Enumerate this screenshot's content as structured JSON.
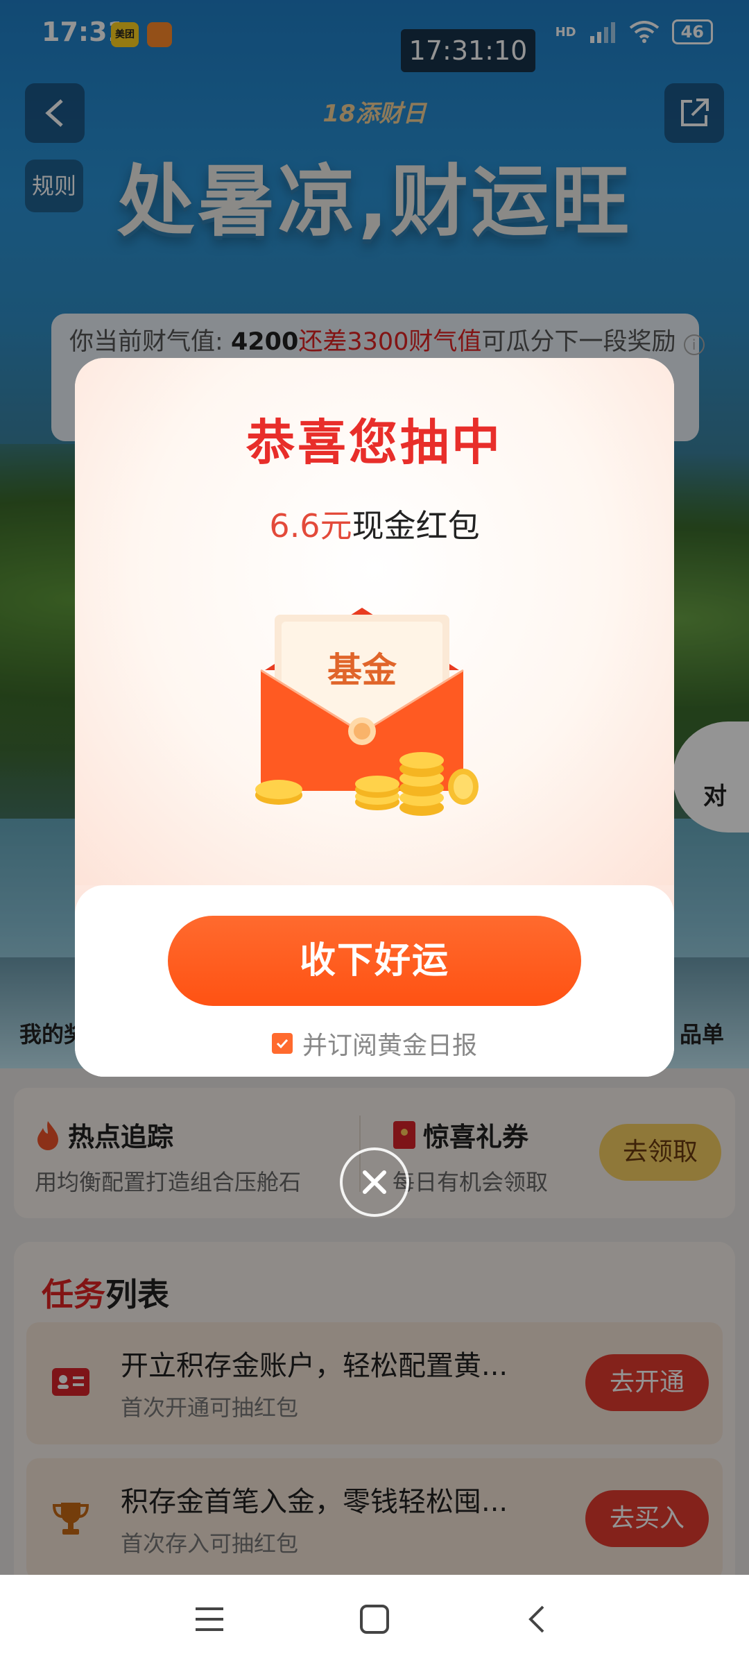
{
  "status_bar": {
    "time": "17:31",
    "app_badge": "美团",
    "clock_overlay": "17:31:10",
    "network": "HD",
    "battery": "46"
  },
  "header": {
    "rules_label": "规则",
    "event_subtitle": "18添财日",
    "event_title": "处暑凉,财运旺"
  },
  "wealth": {
    "prefix": "你当前财气值:",
    "value": "4200",
    "gap_text": "还差3300财气值",
    "suffix": "可瓜分下一段奖励"
  },
  "side_badge": {
    "label": "对"
  },
  "mini_row": {
    "left_label": "我的奖",
    "right_label": "品单"
  },
  "features": [
    {
      "title": "热点追踪",
      "desc": "用均衡配置打造组合压舱石"
    },
    {
      "title": "惊喜礼券",
      "desc": "每日有机会领取"
    }
  ],
  "claim_button": "去领取",
  "tasks": {
    "title_red": "任务",
    "title_rest": "列表",
    "items": [
      {
        "name": "开立积存金账户，轻松配置黄...",
        "note": "首次开通可抽红包",
        "button": "去开通"
      },
      {
        "name": "积存金首笔入金，零钱轻松囤...",
        "note": "首次存入可抽红包",
        "button": "去买入"
      }
    ]
  },
  "modal": {
    "heading": "恭喜您抽中",
    "prize_amount": "6.6元",
    "prize_type": "现金红包",
    "envelope_text": "基金",
    "accept_button": "收下好运",
    "subscribe_text": "并订阅黄金日报",
    "subscribe_checked": true
  },
  "colors": {
    "accent": "#ff5a1a",
    "red": "#e82e2a",
    "gold": "#f7cf62"
  }
}
